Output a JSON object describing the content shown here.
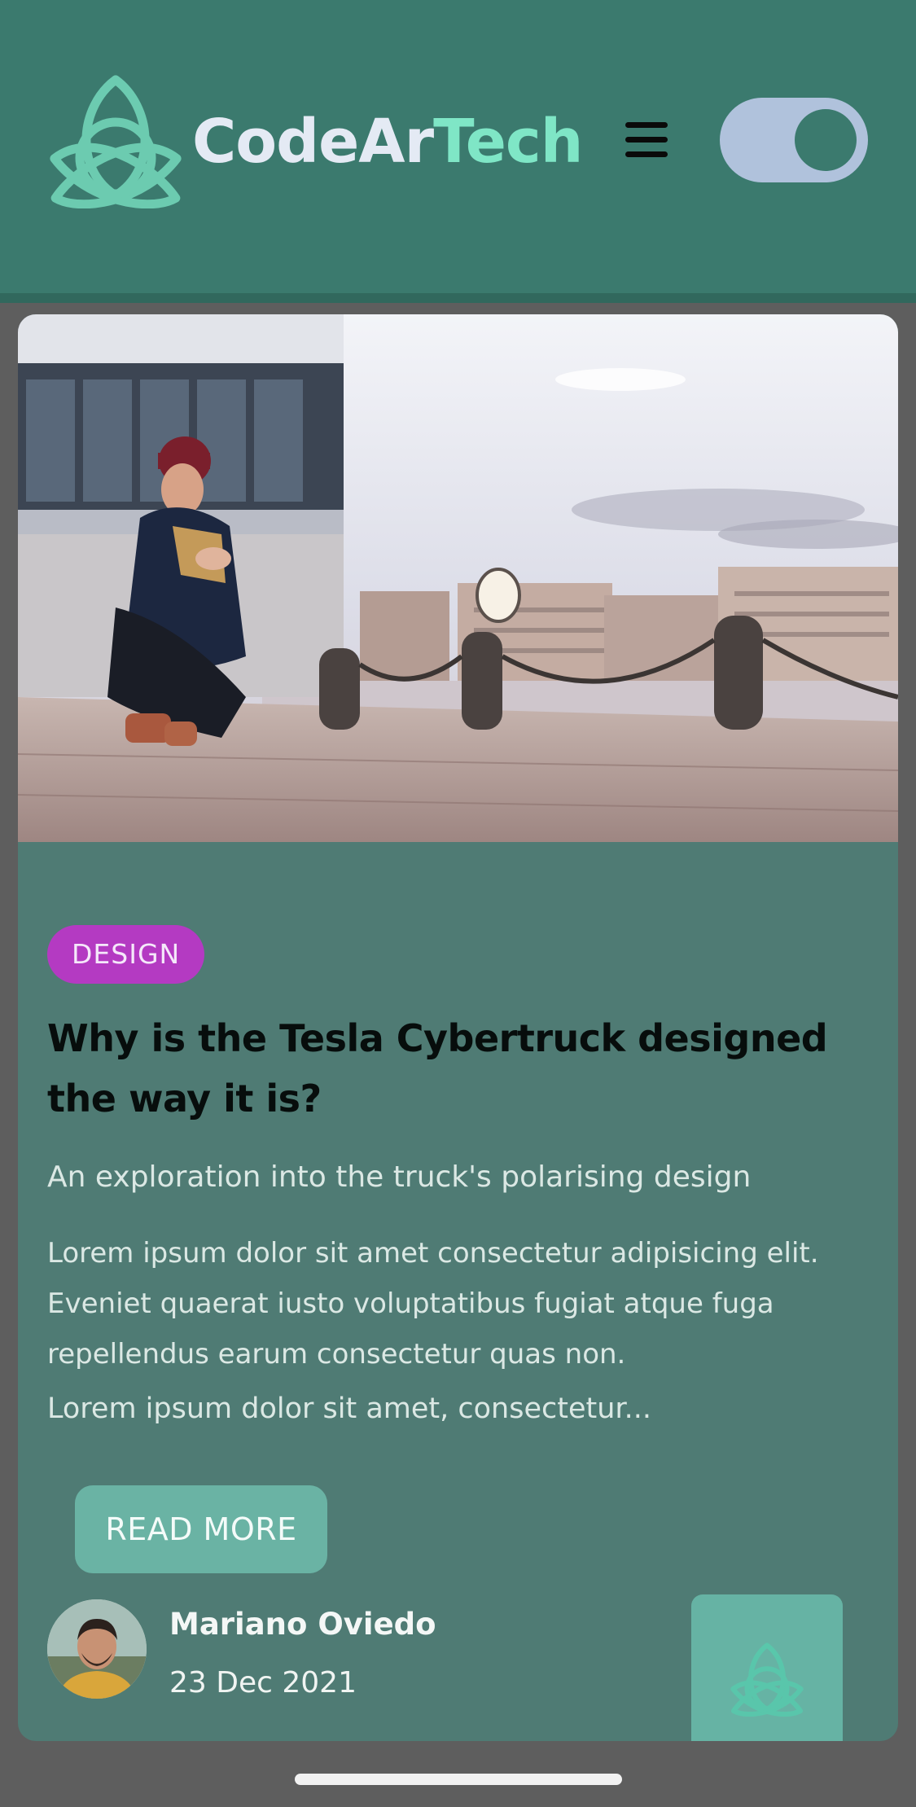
{
  "header": {
    "brand_part1": "CodeAr",
    "brand_part2": "Tech",
    "logo_icon": "triquetra-icon",
    "menu_icon": "hamburger-menu-icon",
    "theme_toggle": "dark-mode-toggle"
  },
  "post": {
    "image": "photo of a man crouching on a waterfront promenade",
    "category": "DESIGN",
    "title": "Why is the Tesla Cybertruck designed the way it is?",
    "subtitle": "An exploration into the truck's polarising design",
    "paragraph": "Lorem ipsum dolor sit amet consectetur adipisicing elit. Eveniet quaerat iusto voluptatibus fugiat atque fuga repellendus earum consectetur quas non.",
    "excerpt": "Lorem ipsum dolor sit amet, consectetur...",
    "read_more_label": "READ MORE",
    "author": {
      "name": "Mariano Oviedo",
      "date": "23 Dec 2021"
    }
  },
  "colors": {
    "header_bg": "#3b7a6e",
    "brand_accent": "#7fe6c6",
    "card_bg": "#4f7b74",
    "badge_bg": "#b43ac2",
    "button_bg": "#6ab3a4",
    "toggle_bg": "#b0c2dc"
  }
}
